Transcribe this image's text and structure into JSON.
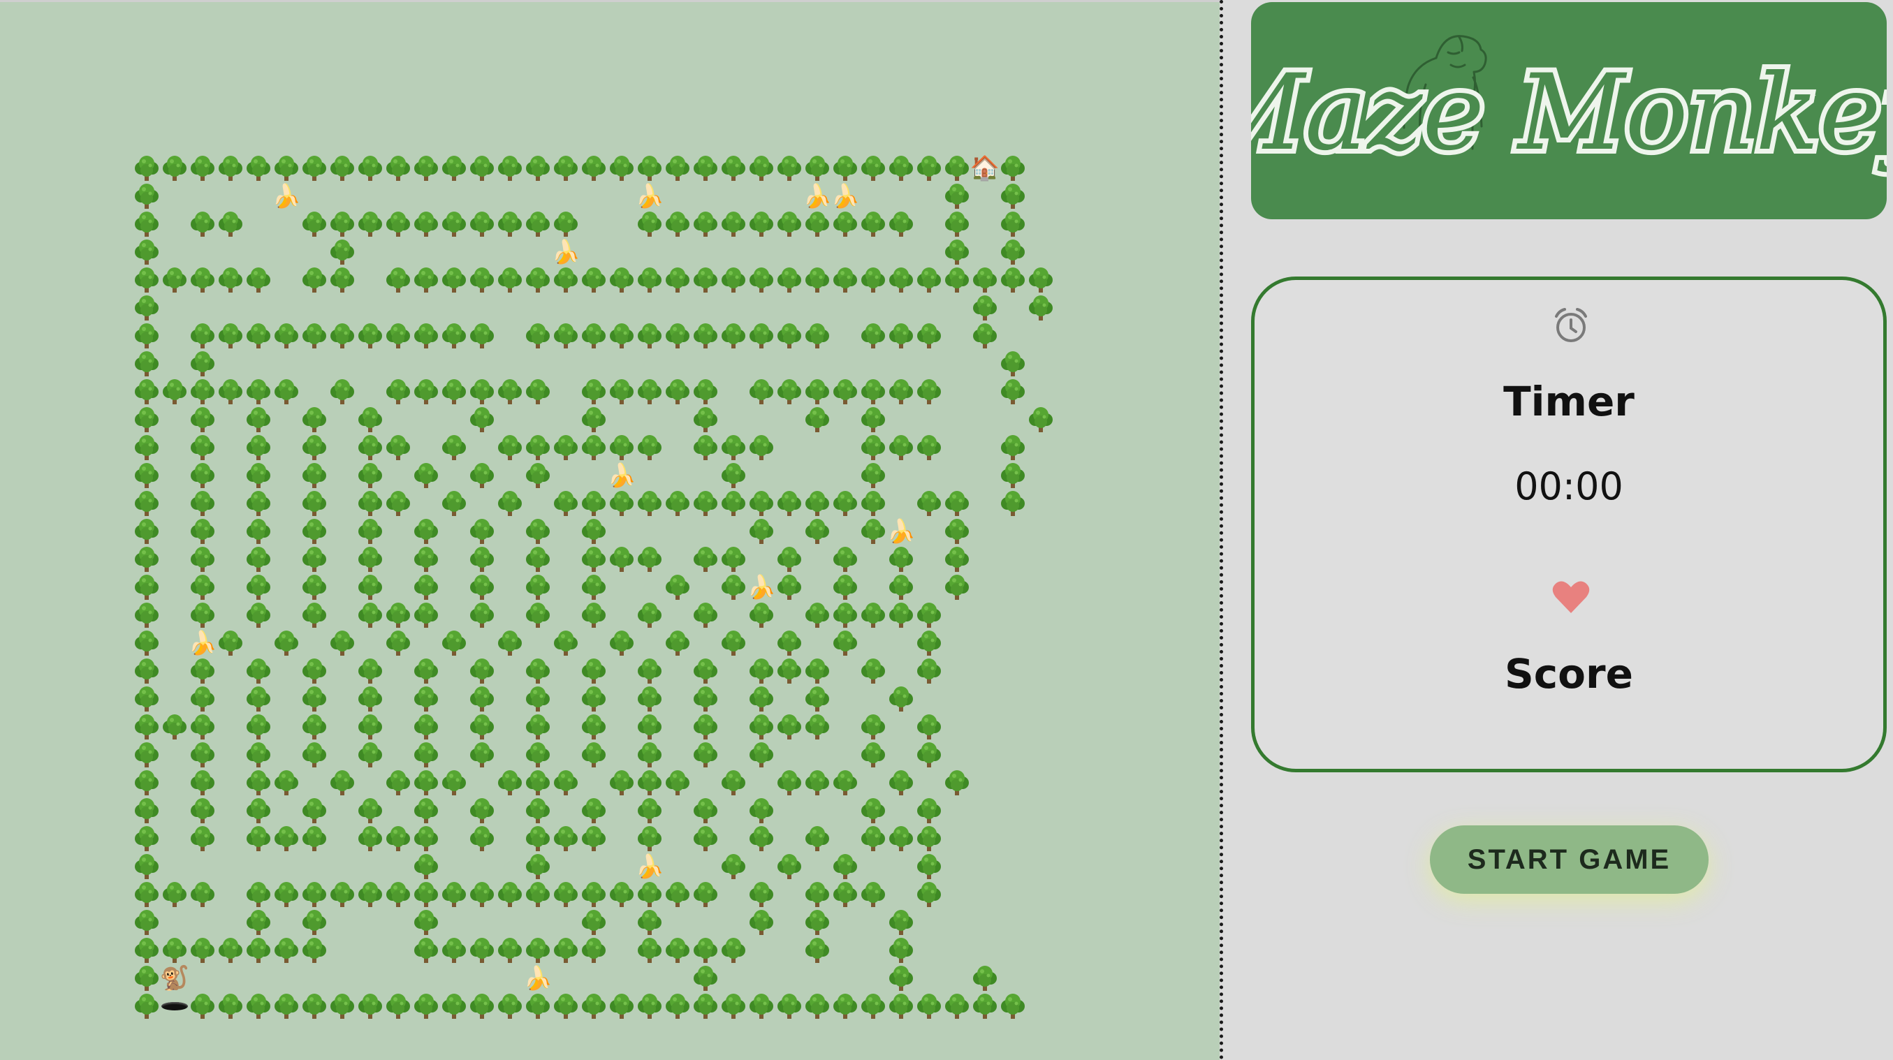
{
  "logo": {
    "title": "Maze Monkey",
    "mascot": "gorilla-outline"
  },
  "timer": {
    "icon": "alarm-clock-icon",
    "label": "Timer",
    "value": "00:00"
  },
  "score": {
    "icon": "heart-icon",
    "label": "Score"
  },
  "start_button": {
    "label": "START GAME"
  },
  "colors": {
    "maze_background": "#b9cfb8",
    "panel_background": "#dcdcdc",
    "logo_background": "#4a8b4e",
    "card_border": "#347a2f",
    "button": "#8fb887",
    "heart": "#e8817f",
    "tree": "#4f9a2e"
  },
  "maze": {
    "rows": 31,
    "cols": 31,
    "legend": {
      "#": "tree",
      ".": "path",
      "B": "banana",
      "H": "house-exit",
      "M": "monkey-player",
      "O": "hole-start"
    },
    "grid": [
      "##############################H#",
      "#....B............B.....BB...#.#",
      "#.##..##########..##########.#.#",
      "#......#.......B.............#.#",
      "#####.##.########################",
      "#.............................#.#",
      "#.###########.###########.###.#",
      "#.#............................#",
      "######.#.######.#####.#######..#",
      "#.#.#.#.#...#...#...#...#.#.....#",
      "#.#.#.#.##.#.######.###...###..#",
      "#.#.#.#.#.#.#.#..B...#....#....#",
      "#.#.#.#.##.#.#.############.##.#",
      "#.#.#.#.#.#.#.#.#.....#.#.#B.#",
      "#.#.#.#.#.#.#.#.###.##.#.#.#.#",
      "#.#.#.#.#.#.#.#.#..#.#B#.#.#.#",
      "#.#.#.#.###.#.#.#.#.#.#.#####",
      "#.B#.#.#.#.#.#.#.#.#.#.#.#..#",
      "#.#.#.#.#.#.#.#.#.#.#.###.#.#",
      "#.#.#.#.#.#.#.#.#.#.#.#.#..#",
      "###.#.#.#.#.#.#.#.#.#.###.#.#",
      "#.#.#.#.#.#.#.#.#.#.#.#...#.#",
      "#.#.##.#.###.###.###.#.###.#.#",
      "#.#.#.#.#.#.#.#.#.#.#.#...#.#",
      "#.#.###.###.#.###.#.#.#.#.###",
      "#.........#...#...B..#.#.#..#",
      "###.#################.#.###.#",
      "#...#.#...#.....#.#...#.#..#",
      "#######...#######.####..#..#",
      "#M............B.....#......#..#",
      "#O##############################"
    ]
  }
}
